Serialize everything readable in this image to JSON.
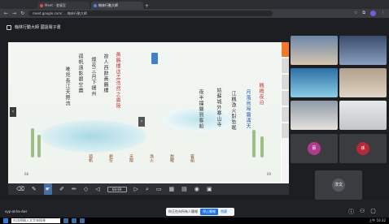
{
  "browser": {
    "tabs": [
      {
        "label": "Meet - 會議室",
        "active": false
      },
      {
        "label": "翰林行動大師",
        "active": true
      }
    ],
    "url": "meet.google.com/ ... 翰林行動大師",
    "new_tab": "+"
  },
  "meet": {
    "title": "翰林行動大師 國語電子書",
    "meeting_code": "ayp-akha-dwr",
    "presenting_text": "你正在向所有人簡報",
    "stop_label": "停止簡報",
    "hide_label": "隱藏"
  },
  "ebook": {
    "poem_columns": [
      {
        "text": "黃鶴樓送孟浩然之廣陵",
        "style": "red"
      },
      {
        "text": "故人西辭黃鶴樓",
        "style": "normal"
      },
      {
        "text": "煙花三月下揚州",
        "style": "normal"
      },
      {
        "text": "孤帆遠影碧空盡",
        "style": "normal"
      },
      {
        "text": "唯見長江天際流",
        "style": "normal"
      },
      {
        "text": "楓橋夜泊",
        "style": "red"
      },
      {
        "text": "月落烏啼霜滿天",
        "style": "blue"
      },
      {
        "text": "江楓漁火對愁眠",
        "style": "normal"
      },
      {
        "text": "姑蘇城外寒山寺",
        "style": "normal"
      },
      {
        "text": "夜半鐘聲到客船",
        "style": "normal"
      }
    ],
    "glosses": [
      "孤帆",
      "碧空",
      "天際",
      "漁火",
      "愁眠",
      "客船"
    ],
    "page_left": "68",
    "page_right": "69",
    "page_indicator": "68-69"
  },
  "toolbar": {
    "tools": [
      "eraser-icon",
      "pen-icon",
      "select-icon",
      "highlighter-icon",
      "marker-icon",
      "shape-icon",
      "line-icon",
      "text-icon",
      "zoom-icon",
      "prev-icon",
      "next-icon",
      "fit-icon",
      "grid-icon",
      "note-icon",
      "camera-icon",
      "save-icon"
    ]
  },
  "participants": [
    {
      "name": "蔡",
      "color": "#b03a8c"
    },
    {
      "name": "孫",
      "color": "#b5283a"
    },
    {
      "name": "淳文",
      "color": "#555a61"
    }
  ],
  "taskbar": {
    "search_placeholder": "在這裡輸入文字來搜尋",
    "clock": "上午 10:32"
  }
}
